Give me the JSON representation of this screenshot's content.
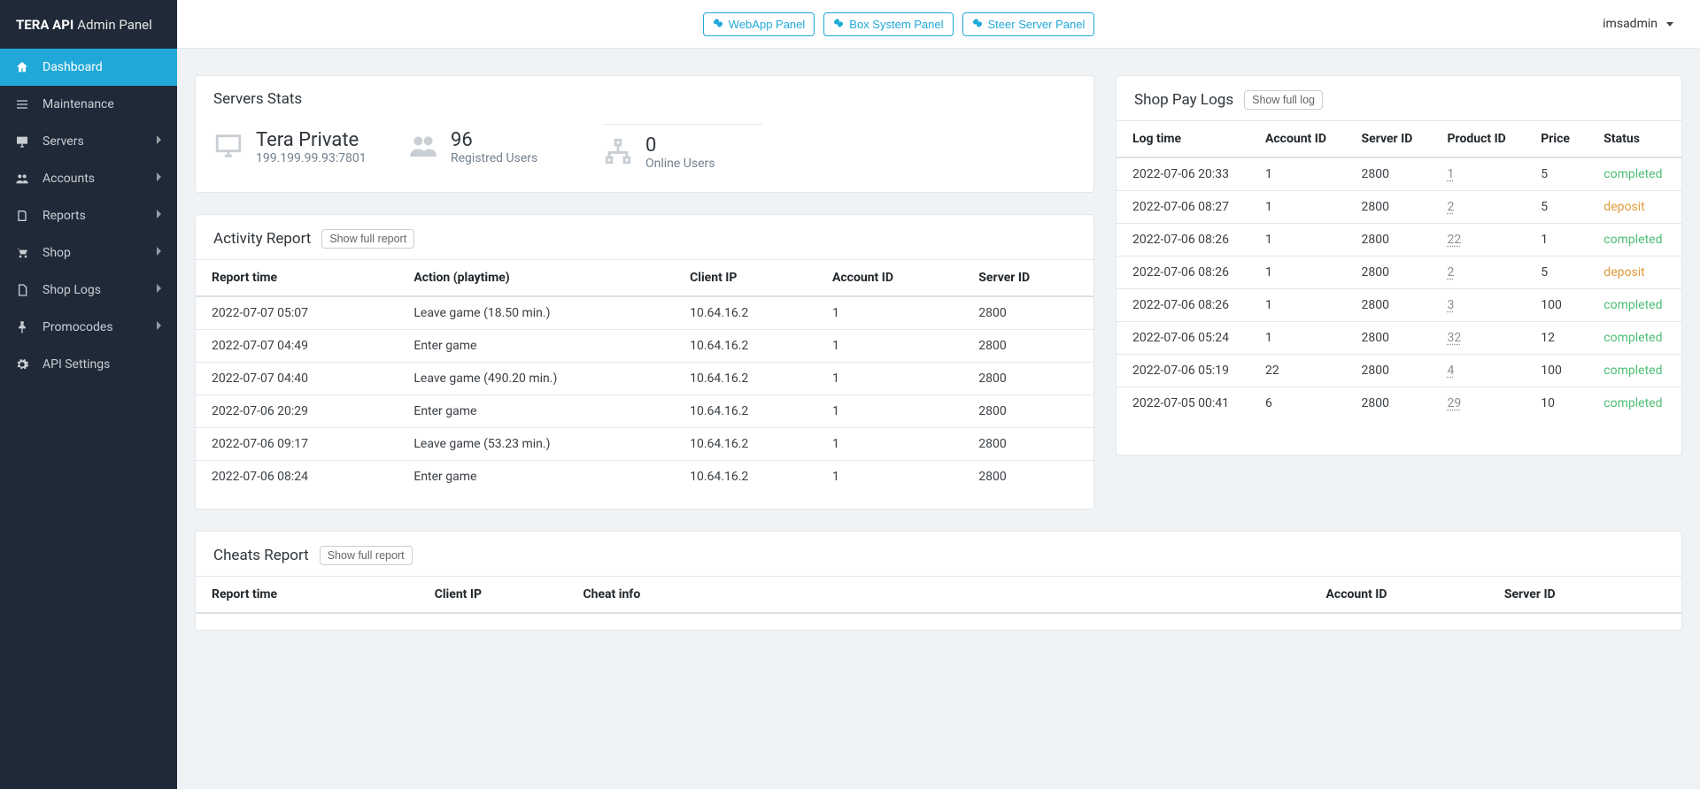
{
  "brand": {
    "bold": "TERA API",
    "light": "Admin Panel"
  },
  "topbar": {
    "buttons": {
      "webapp": "WebApp Panel",
      "boxsystem": "Box System Panel",
      "steerserver": "Steer Server Panel"
    },
    "user": "imsadmin"
  },
  "sidebar": {
    "items": [
      {
        "label": "Dashboard",
        "active": true
      },
      {
        "label": "Maintenance"
      },
      {
        "label": "Servers",
        "expandable": true
      },
      {
        "label": "Accounts",
        "expandable": true
      },
      {
        "label": "Reports",
        "expandable": true
      },
      {
        "label": "Shop",
        "expandable": true
      },
      {
        "label": "Shop Logs",
        "expandable": true
      },
      {
        "label": "Promocodes",
        "expandable": true
      },
      {
        "label": "API Settings"
      }
    ]
  },
  "stats": {
    "title": "Servers Stats",
    "server_name": "Tera Private",
    "server_addr": "199.199.99.93:7801",
    "registered_count": "96",
    "registered_label": "Registred Users",
    "online_count": "0",
    "online_label": "Online Users"
  },
  "activity": {
    "title": "Activity Report",
    "show_full": "Show full report",
    "columns": {
      "time": "Report time",
      "action": "Action (playtime)",
      "ip": "Client IP",
      "account": "Account ID",
      "server": "Server ID"
    },
    "rows": [
      {
        "time": "2022-07-07 05:07",
        "action": "Leave game (18.50 min.)",
        "ip": "10.64.16.2",
        "account": "1",
        "server": "2800"
      },
      {
        "time": "2022-07-07 04:49",
        "action": "Enter game",
        "ip": "10.64.16.2",
        "account": "1",
        "server": "2800"
      },
      {
        "time": "2022-07-07 04:40",
        "action": "Leave game (490.20 min.)",
        "ip": "10.64.16.2",
        "account": "1",
        "server": "2800"
      },
      {
        "time": "2022-07-06 20:29",
        "action": "Enter game",
        "ip": "10.64.16.2",
        "account": "1",
        "server": "2800"
      },
      {
        "time": "2022-07-06 09:17",
        "action": "Leave game (53.23 min.)",
        "ip": "10.64.16.2",
        "account": "1",
        "server": "2800"
      },
      {
        "time": "2022-07-06 08:24",
        "action": "Enter game",
        "ip": "10.64.16.2",
        "account": "1",
        "server": "2800"
      }
    ]
  },
  "shoplogs": {
    "title": "Shop Pay Logs",
    "show_full": "Show full log",
    "columns": {
      "time": "Log time",
      "account": "Account ID",
      "server": "Server ID",
      "product": "Product ID",
      "price": "Price",
      "status": "Status"
    },
    "rows": [
      {
        "time": "2022-07-06 20:33",
        "account": "1",
        "server": "2800",
        "product": "1",
        "price": "5",
        "status": "completed"
      },
      {
        "time": "2022-07-06 08:27",
        "account": "1",
        "server": "2800",
        "product": "2",
        "price": "5",
        "status": "deposit"
      },
      {
        "time": "2022-07-06 08:26",
        "account": "1",
        "server": "2800",
        "product": "22",
        "price": "1",
        "status": "completed"
      },
      {
        "time": "2022-07-06 08:26",
        "account": "1",
        "server": "2800",
        "product": "2",
        "price": "5",
        "status": "deposit"
      },
      {
        "time": "2022-07-06 08:26",
        "account": "1",
        "server": "2800",
        "product": "3",
        "price": "100",
        "status": "completed"
      },
      {
        "time": "2022-07-06 05:24",
        "account": "1",
        "server": "2800",
        "product": "32",
        "price": "12",
        "status": "completed"
      },
      {
        "time": "2022-07-06 05:19",
        "account": "22",
        "server": "2800",
        "product": "4",
        "price": "100",
        "status": "completed"
      },
      {
        "time": "2022-07-05 00:41",
        "account": "6",
        "server": "2800",
        "product": "29",
        "price": "10",
        "status": "completed"
      }
    ]
  },
  "cheats": {
    "title": "Cheats Report",
    "show_full": "Show full report",
    "columns": {
      "time": "Report time",
      "ip": "Client IP",
      "info": "Cheat info",
      "account": "Account ID",
      "server": "Server ID"
    }
  }
}
